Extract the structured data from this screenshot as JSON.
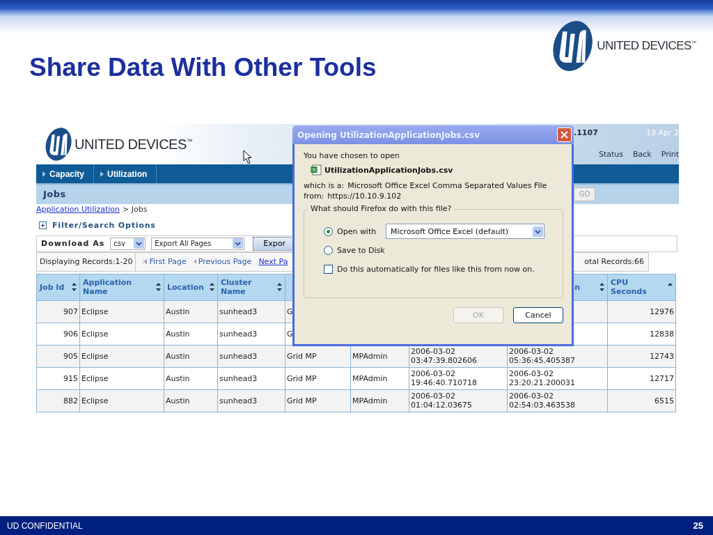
{
  "slide": {
    "title": "Share Data With Other Tools",
    "logo_text": "UNITED DEVICES$^{™}$",
    "footer_left": "UD CONFIDENTIAL",
    "page_number": "25"
  },
  "app": {
    "header": {
      "logo_text": "UNITED DEVICES$^{™}$",
      "build": ".1107",
      "date": "19 Apr 2",
      "links": [
        "Status",
        "Back",
        "Print"
      ]
    },
    "nav_tabs": [
      {
        "label": "Capacity",
        "selected": false
      },
      {
        "label": "Utilization",
        "selected": false
      }
    ],
    "section_title": "Jobs",
    "go_button": "GO",
    "breadcrumb": {
      "link": "Application Utilization",
      "rest": "> Jobs"
    },
    "filter_toggle": "Filter/Search Options",
    "download": {
      "label": "Download As",
      "format": "csv",
      "scope": "Export All Pages",
      "button": "Expor"
    },
    "paging": {
      "displaying": "Displaying Records:1-20",
      "first": "First Page",
      "previous": "Previous Page",
      "next": "Next Pa",
      "total": "otal Records:66"
    },
    "table": {
      "columns": [
        {
          "label": "Job Id",
          "sort_up": true,
          "sort_down": true
        },
        {
          "label": "Application Name",
          "sort_up": true,
          "sort_down": true
        },
        {
          "label": "Location",
          "sort_up": true,
          "sort_down": true
        },
        {
          "label": "Cluster Name",
          "sort_up": true,
          "sort_down": true
        },
        null,
        null,
        null,
        {
          "label": "n",
          "sort_up": true,
          "sort_down": true
        },
        {
          "label": "CPU Seconds",
          "sort_up": true,
          "sort_down": false
        }
      ],
      "rows": [
        [
          "907",
          "Eclipse",
          "Austin",
          "sunhead3",
          "G",
          null,
          null,
          null,
          "12976"
        ],
        [
          "906",
          "Eclipse",
          "Austin",
          "sunhead3",
          "G",
          null,
          null,
          null,
          "12838"
        ],
        [
          "905",
          "Eclipse",
          "Austin",
          "sunhead3",
          "Grid MP",
          "MPAdmin",
          "2006-03-02 03:47:39.802606",
          "2006-03-02 05:36:45.405387",
          "12743"
        ],
        [
          "915",
          "Eclipse",
          "Austin",
          "sunhead3",
          "Grid MP",
          "MPAdmin",
          "2006-03-02 19:46:40.710718",
          "2006-03-02 23:20:21.200031",
          "12717"
        ],
        [
          "882",
          "Eclipse",
          "Austin",
          "sunhead3",
          "Grid MP",
          "MPAdmin",
          "2006-03-02 01:04:12.03675",
          "2006-03-02 02:54:03.463538",
          "6515"
        ]
      ]
    }
  },
  "dialog": {
    "title": "Opening UtilizationApplicationJobs.csv",
    "intro": "You have chosen to open",
    "file_name": "UtilizationApplicationJobs.csv",
    "type_label": "which is a:",
    "type_value": "Microsoft Office Excel Comma Separated Values File",
    "from_label": "from:",
    "from_value": "https://10.10.9.102",
    "group_label": "What should Firefox do with this file?",
    "options": [
      {
        "label": "Open with",
        "selected": true
      },
      {
        "label": "Save to Disk",
        "selected": false
      }
    ],
    "open_with_app": "Microsoft Office Excel (default)",
    "auto_checkbox": {
      "label": "Do this automatically for files like this from now on.",
      "checked": false
    },
    "buttons": [
      {
        "label": "OK",
        "disabled": true
      },
      {
        "label": "Cancel",
        "disabled": false
      }
    ]
  }
}
